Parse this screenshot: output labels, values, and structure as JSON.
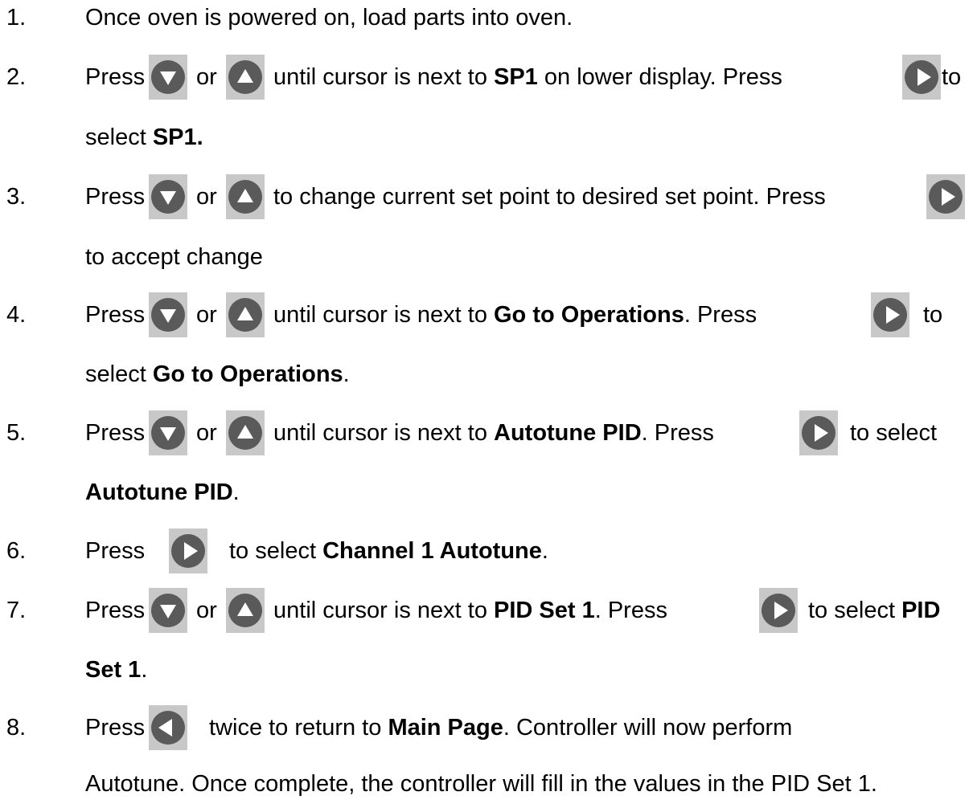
{
  "steps": [
    {
      "number": "1.",
      "line1": {
        "a": "Once oven is powered on, load parts into oven."
      }
    },
    {
      "number": "2.",
      "line1": {
        "press": "Press",
        "or": "or",
        "a": "until cursor is next to ",
        "b": "SP1",
        "c": " on lower display.  Press",
        "d": "to"
      },
      "line2": {
        "a": "select ",
        "b": "SP1."
      }
    },
    {
      "number": "3.",
      "line1": {
        "press": "Press",
        "or": "or",
        "a": "to change current set point to desired set point. Press"
      },
      "line2": {
        "a": "to accept change"
      }
    },
    {
      "number": "4.",
      "line1": {
        "press": "Press",
        "or": "or",
        "a": "until cursor is next to ",
        "b": "Go to Operations",
        "c": ".  Press",
        "d": "to"
      },
      "line2": {
        "a": "select ",
        "b": "Go to Operations",
        "c": "."
      }
    },
    {
      "number": "5.",
      "line1": {
        "press": "Press",
        "or": "or",
        "a": "until cursor is next to ",
        "b": "Autotune PID",
        "c": ". Press",
        "d": "to select"
      },
      "line2": {
        "b": "Autotune PID",
        "c": "."
      }
    },
    {
      "number": "6.",
      "line1": {
        "press": "Press",
        "a": "to select ",
        "b": "Channel 1 Autotune",
        "c": "."
      }
    },
    {
      "number": "7.",
      "line1": {
        "press": "Press",
        "or": "or",
        "a": "until cursor is next to ",
        "b": "PID Set 1",
        "c": ". Press",
        "d": "to select ",
        "e": "PID"
      },
      "line2": {
        "b": "Set 1",
        "c": "."
      }
    },
    {
      "number": "8.",
      "line1": {
        "press": "Press",
        "a": "twice to return to ",
        "b": "Main Page",
        "c": ".  Controller will now perform"
      },
      "line2": {
        "a": "Autotune.  Once complete, the controller will fill in the values in the PID Set 1."
      }
    }
  ],
  "icons": {
    "down": "down-arrow-button-icon",
    "up": "up-arrow-button-icon",
    "right": "right-arrow-button-icon",
    "left": "left-arrow-button-icon"
  },
  "colors": {
    "button_bg": "#c8c8c8",
    "button_fill": "#5a5a5a",
    "arrow": "#ffffff",
    "text": "#000000"
  }
}
